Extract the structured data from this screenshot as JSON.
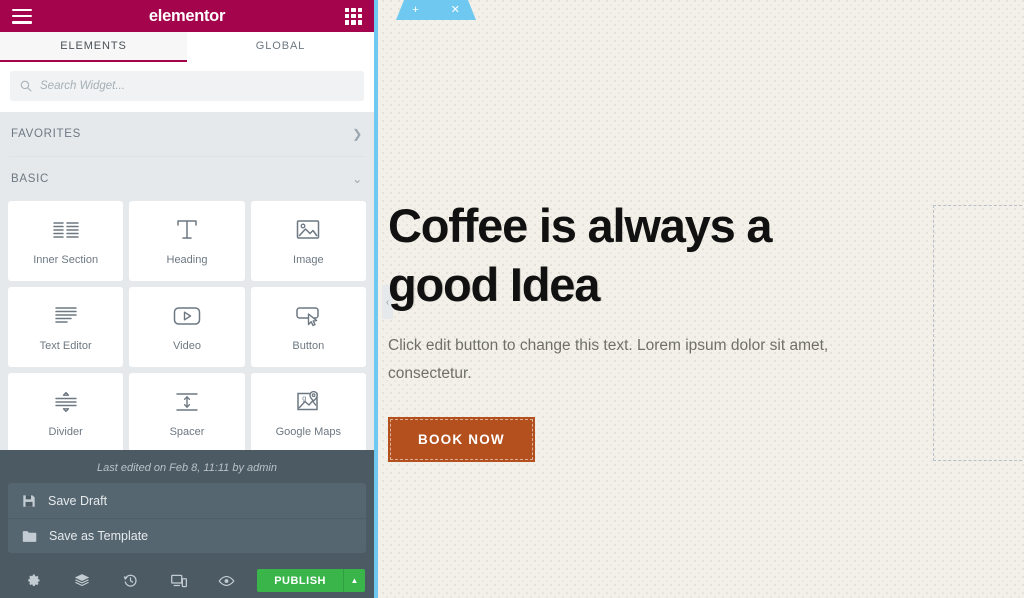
{
  "panel": {
    "header": {
      "menu_icon": "hamburger-icon",
      "brand": "elementor",
      "apps_icon": "grid-apps-icon"
    },
    "tabs": [
      {
        "label": "ELEMENTS",
        "active": true
      },
      {
        "label": "GLOBAL",
        "active": false
      }
    ],
    "search": {
      "icon": "search-icon",
      "value": "",
      "placeholder": "Search Widget..."
    },
    "categories": [
      {
        "label": "FAVORITES",
        "chevron": "chevron-right-icon",
        "expanded": false
      },
      {
        "label": "BASIC",
        "chevron": "chevron-down-icon",
        "expanded": true
      }
    ],
    "widgets": [
      {
        "label": "Inner Section",
        "icon": "columns-icon"
      },
      {
        "label": "Heading",
        "icon": "heading-t-icon"
      },
      {
        "label": "Image",
        "icon": "image-icon"
      },
      {
        "label": "Text Editor",
        "icon": "text-lines-icon"
      },
      {
        "label": "Video",
        "icon": "video-play-icon"
      },
      {
        "label": "Button",
        "icon": "button-cursor-icon"
      },
      {
        "label": "Divider",
        "icon": "divider-icon"
      },
      {
        "label": "Spacer",
        "icon": "spacer-icon"
      },
      {
        "label": "Google Maps",
        "icon": "map-pin-icon"
      }
    ]
  },
  "footer": {
    "last_edited": "Last edited on Feb 8, 11:11 by admin",
    "save_options": [
      {
        "label": "Save Draft",
        "icon": "floppy-disk-icon"
      },
      {
        "label": "Save as Template",
        "icon": "folder-icon"
      }
    ],
    "toolbar_icons": [
      {
        "name": "settings-gear-icon",
        "title": "Settings"
      },
      {
        "name": "navigator-layers-icon",
        "title": "Navigator"
      },
      {
        "name": "history-clock-icon",
        "title": "History"
      },
      {
        "name": "responsive-devices-icon",
        "title": "Responsive Mode"
      },
      {
        "name": "preview-eye-icon",
        "title": "Preview Changes"
      }
    ],
    "publish": {
      "label": "PUBLISH",
      "caret": "caret-up-icon",
      "color": "#39b54a"
    }
  },
  "canvas": {
    "section_toolbar": {
      "add_icon": "plus-icon",
      "drag_icon": "drag-dots-icon",
      "close_icon": "close-x-icon",
      "color": "#6ec8ef"
    },
    "collapse_tab": {
      "icon": "chevron-left-icon"
    },
    "heading": {
      "line1": "Coffee is always a",
      "line2": "good Idea",
      "ghost_line": "good Idea"
    },
    "paragraph": "Click edit button to change this text. Lorem ipsum dolor sit amet, consectetur.",
    "cta_button": {
      "label": "BOOK NOW",
      "background": "#b4501e"
    },
    "empty_column_placeholder": true,
    "background_color": "#f2f0e8"
  }
}
